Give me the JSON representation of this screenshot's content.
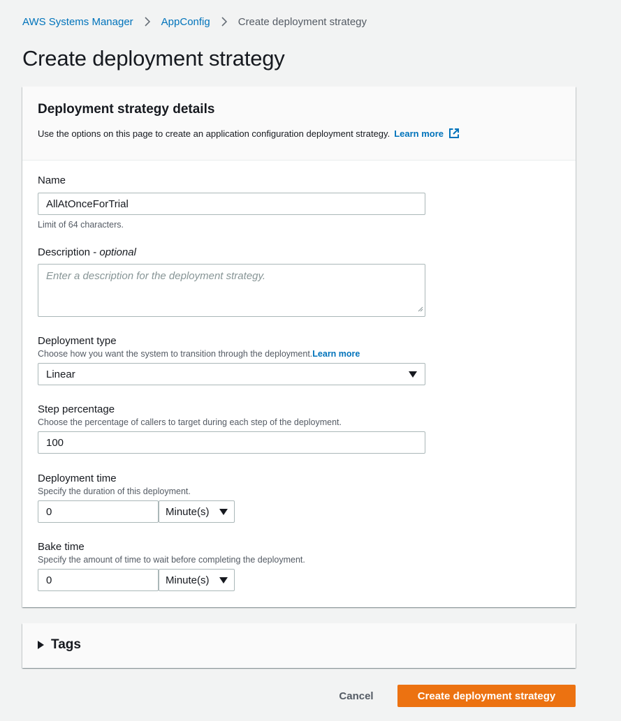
{
  "breadcrumb": {
    "items": [
      "AWS Systems Manager",
      "AppConfig"
    ],
    "current": "Create deployment strategy"
  },
  "page_title": "Create deployment strategy",
  "details_panel": {
    "title": "Deployment strategy details",
    "description": "Use the options on this page to create an application configuration deployment strategy.",
    "learn_more": "Learn more"
  },
  "name_field": {
    "label": "Name",
    "value": "AllAtOnceForTrial",
    "constraint": "Limit of 64 characters."
  },
  "description_field": {
    "label": "Description",
    "optional": "optional",
    "placeholder": "Enter a description for the deployment strategy."
  },
  "deployment_type": {
    "label": "Deployment type",
    "hint": "Choose how you want the system to transition through the deployment.",
    "learn_more": "Learn more",
    "selected": "Linear"
  },
  "step_percentage": {
    "label": "Step percentage",
    "hint": "Choose the percentage of callers to target during each step of the deployment.",
    "value": "100"
  },
  "deployment_time": {
    "label": "Deployment time",
    "hint": "Specify the duration of this deployment.",
    "value": "0",
    "unit": "Minute(s)"
  },
  "bake_time": {
    "label": "Bake time",
    "hint": "Specify the amount of time to wait before completing the deployment.",
    "value": "0",
    "unit": "Minute(s)"
  },
  "tags_panel": {
    "title": "Tags"
  },
  "actions": {
    "cancel": "Cancel",
    "submit": "Create deployment strategy"
  },
  "colors": {
    "link": "#0073bb",
    "primary": "#ec7211",
    "background": "#f2f3f3"
  }
}
